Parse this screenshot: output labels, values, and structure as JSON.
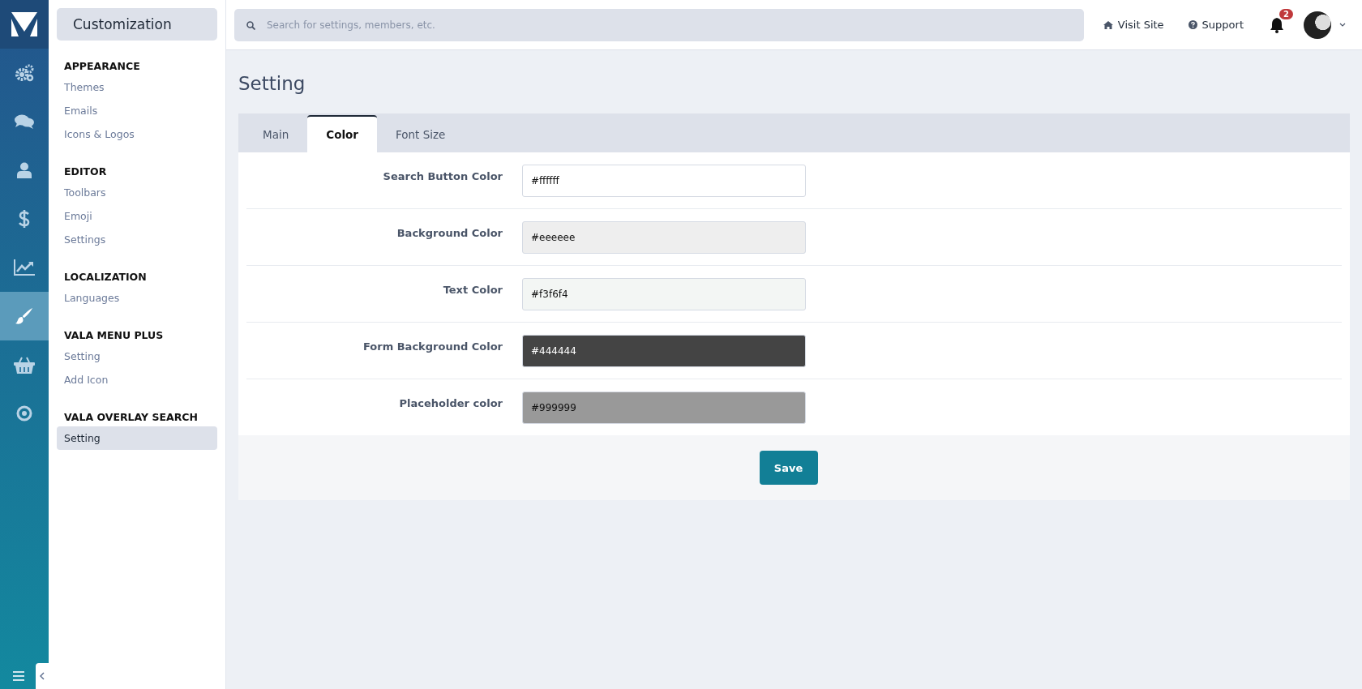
{
  "nav_rail": {
    "items": [
      {
        "kind": "gears",
        "selected": false
      },
      {
        "kind": "chat",
        "selected": false
      },
      {
        "kind": "user",
        "selected": false
      },
      {
        "kind": "dollar",
        "selected": false
      },
      {
        "kind": "chart",
        "selected": false
      },
      {
        "kind": "brush",
        "selected": true
      },
      {
        "kind": "basket",
        "selected": false
      },
      {
        "kind": "target",
        "selected": false
      }
    ]
  },
  "sidebar": {
    "title": "Customization",
    "sections": [
      {
        "heading": "APPEARANCE",
        "items": [
          {
            "label": "Themes",
            "selected": false
          },
          {
            "label": "Emails",
            "selected": false
          },
          {
            "label": "Icons & Logos",
            "selected": false
          }
        ]
      },
      {
        "heading": "EDITOR",
        "items": [
          {
            "label": "Toolbars",
            "selected": false
          },
          {
            "label": "Emoji",
            "selected": false
          },
          {
            "label": "Settings",
            "selected": false
          }
        ]
      },
      {
        "heading": "LOCALIZATION",
        "items": [
          {
            "label": "Languages",
            "selected": false
          }
        ]
      },
      {
        "heading": "VALA MENU PLUS",
        "items": [
          {
            "label": "Setting",
            "selected": false
          },
          {
            "label": "Add Icon",
            "selected": false
          }
        ]
      },
      {
        "heading": "VALA OVERLAY SEARCH",
        "items": [
          {
            "label": "Setting",
            "selected": true
          }
        ]
      }
    ]
  },
  "top_bar": {
    "search": {
      "placeholder": "Search for settings, members, etc."
    },
    "links": [
      {
        "kind": "home",
        "label": "Visit Site"
      },
      {
        "kind": "help",
        "label": "Support"
      }
    ],
    "notifications": {
      "count": "2"
    }
  },
  "page": {
    "title": "Setting",
    "tabs": [
      {
        "label": "Main",
        "selected": false
      },
      {
        "label": "Color",
        "selected": true
      },
      {
        "label": "Font Size",
        "selected": false
      }
    ],
    "fields": [
      {
        "label": "Search Button Color",
        "value": "#ffffff",
        "color": "#ffffff"
      },
      {
        "label": "Background Color",
        "value": "#eeeeee",
        "color": "#eeeeee"
      },
      {
        "label": "Text Color",
        "value": "#f3f6f4",
        "color": "#f3f6f4"
      },
      {
        "label": "Form Background Color",
        "value": "#444444",
        "color": "#444444"
      },
      {
        "label": "Placeholder color",
        "value": "#999999",
        "color": "#999999"
      }
    ],
    "save_button": "Save"
  }
}
